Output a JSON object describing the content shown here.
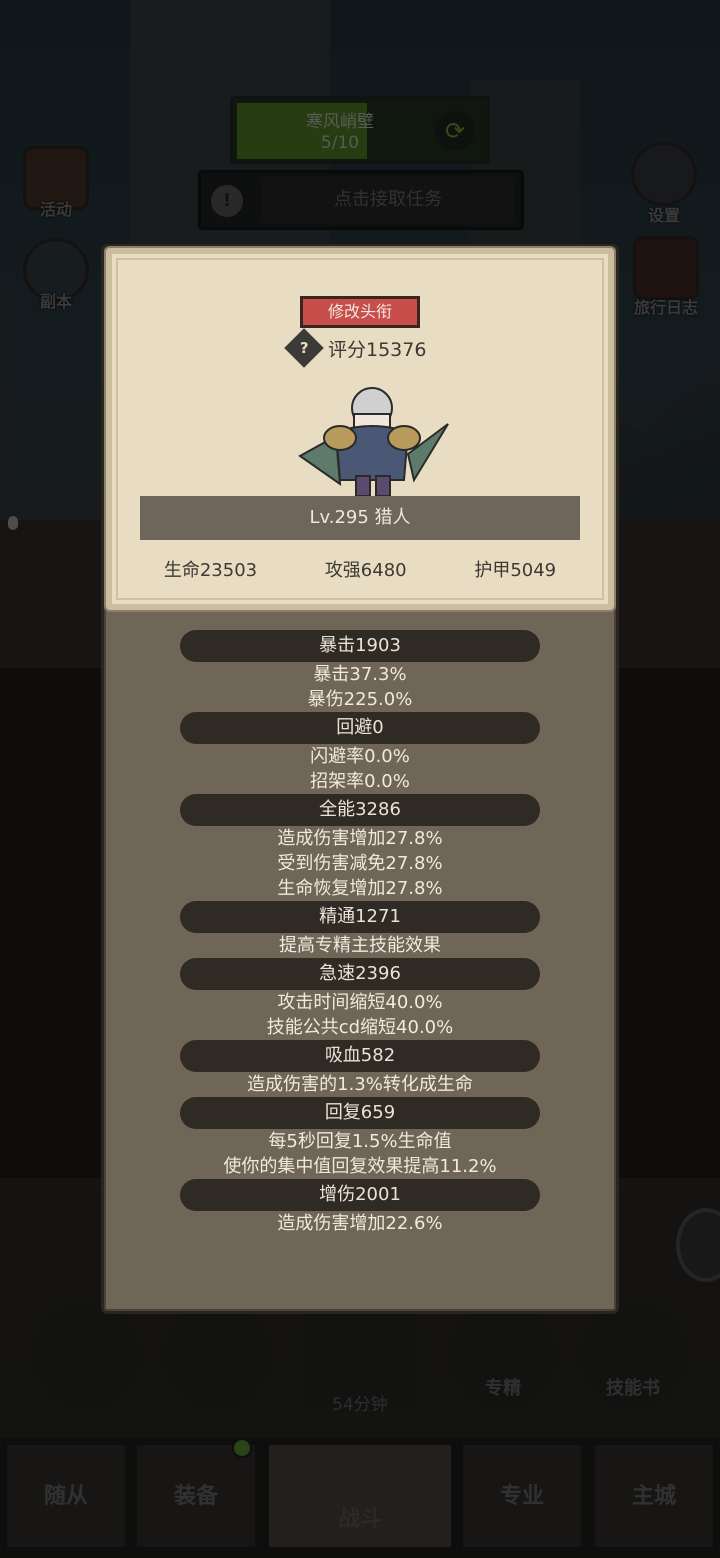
{
  "hud": {
    "quest_name": "寒风峭壁",
    "quest_progress": "5/10",
    "task_label": "点击接取任务"
  },
  "side_buttons": {
    "activity": "活动",
    "dungeon": "副本",
    "settings": "设置",
    "travel_log": "旅行日志"
  },
  "panel": {
    "change_title_label": "修改头衔",
    "score": "评分15376",
    "name": "Lv.295 猎人",
    "stats": {
      "hp": "生命23503",
      "attack": "攻强6480",
      "armor": "护甲5049"
    },
    "sections": [
      {
        "head": "暴击1903",
        "lines": [
          "暴击37.3%",
          "暴伤225.0%"
        ]
      },
      {
        "head": "回避0",
        "lines": [
          "闪避率0.0%",
          "招架率0.0%"
        ]
      },
      {
        "head": "全能3286",
        "lines": [
          "造成伤害增加27.8%",
          "受到伤害减免27.8%",
          "生命恢复增加27.8%"
        ]
      },
      {
        "head": "精通1271",
        "lines": [
          "提高专精主技能效果"
        ]
      },
      {
        "head": "急速2396",
        "lines": [
          "攻击时间缩短40.0%",
          "技能公共cd缩短40.0%"
        ]
      },
      {
        "head": "吸血582",
        "lines": [
          "造成伤害的1.3%转化成生命"
        ]
      },
      {
        "head": "回复659",
        "lines": [
          "每5秒回复1.5%生命值",
          "使你的集中值回复效果提高11.2%"
        ]
      },
      {
        "head": "增伤2001",
        "lines": [
          "造成伤害增加22.6%"
        ]
      }
    ]
  },
  "actions": {
    "specialization": "专精",
    "skill_book": "技能书",
    "timer": "54分钟"
  },
  "nav": {
    "followers": "随从",
    "equipment": "装备",
    "battle": "战斗",
    "profession": "专业",
    "main_city": "主城"
  },
  "colors": {
    "panel_bg": "#6f6658",
    "card_bg": "#e8dcc3",
    "title_button": "#c84e4b",
    "section_pill": "#302a24"
  }
}
